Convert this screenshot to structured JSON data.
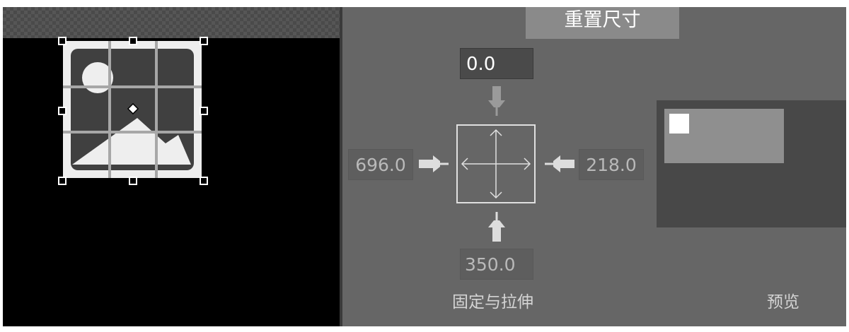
{
  "reset_button_label": "重置尺寸",
  "anchor": {
    "top": "0.0",
    "left": "696.0",
    "right": "218.0",
    "bottom": "350.0"
  },
  "labels": {
    "anchor_stretch": "固定与拉伸",
    "preview": "预览"
  },
  "icons": {
    "image_placeholder": "image-icon",
    "pin": "pin-icon",
    "anchor_arrows": "move-arrows-icon"
  }
}
